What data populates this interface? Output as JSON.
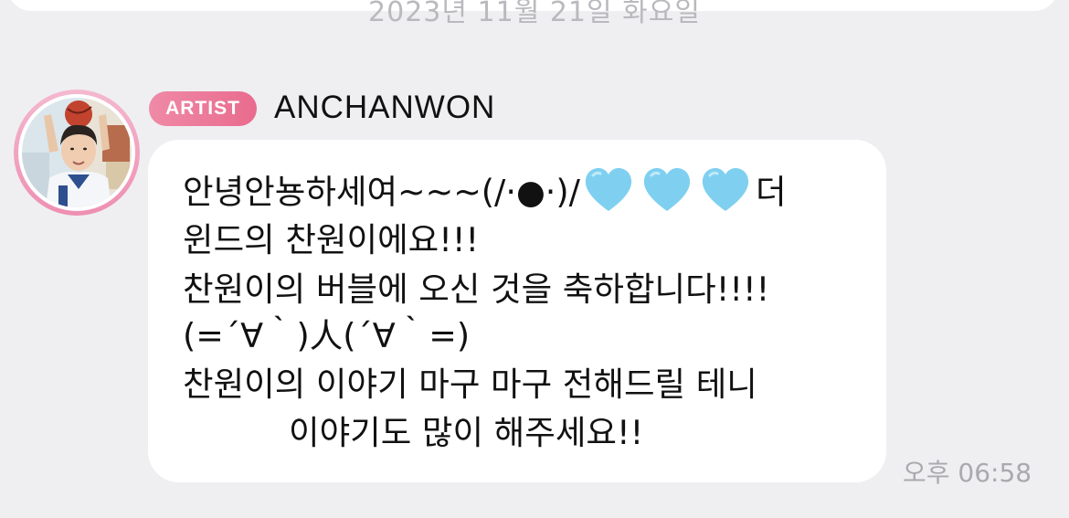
{
  "date_divider": "2023년 11월 21일 화요일",
  "message": {
    "badge": "ARTIST",
    "sender": "ANCHANWON",
    "line1_before": "안녕안뇽하세여~~~(/·●·)/",
    "line1_after": "더",
    "line2": "윈드의 찬원이에요!!!",
    "line3": "찬원이의 버블에 오신 것을 축하합니다!!!!",
    "line4": "(=´∀｀)人(´∀｀=)",
    "line5": "찬원이의 이야기 마구 마구 전해드릴 테니",
    "line6": "이야기도 많이 해주세요!!",
    "timestamp": "오후 06:58"
  },
  "icons": {
    "heart": "light-blue-heart-icon",
    "heart_color": "#7fd0f0"
  },
  "colors": {
    "background": "#efeff1",
    "badge_pink": "#e96b8e",
    "avatar_ring": "#ee8fb1",
    "bubble": "#ffffff",
    "timestamp": "#a9a9ae"
  }
}
